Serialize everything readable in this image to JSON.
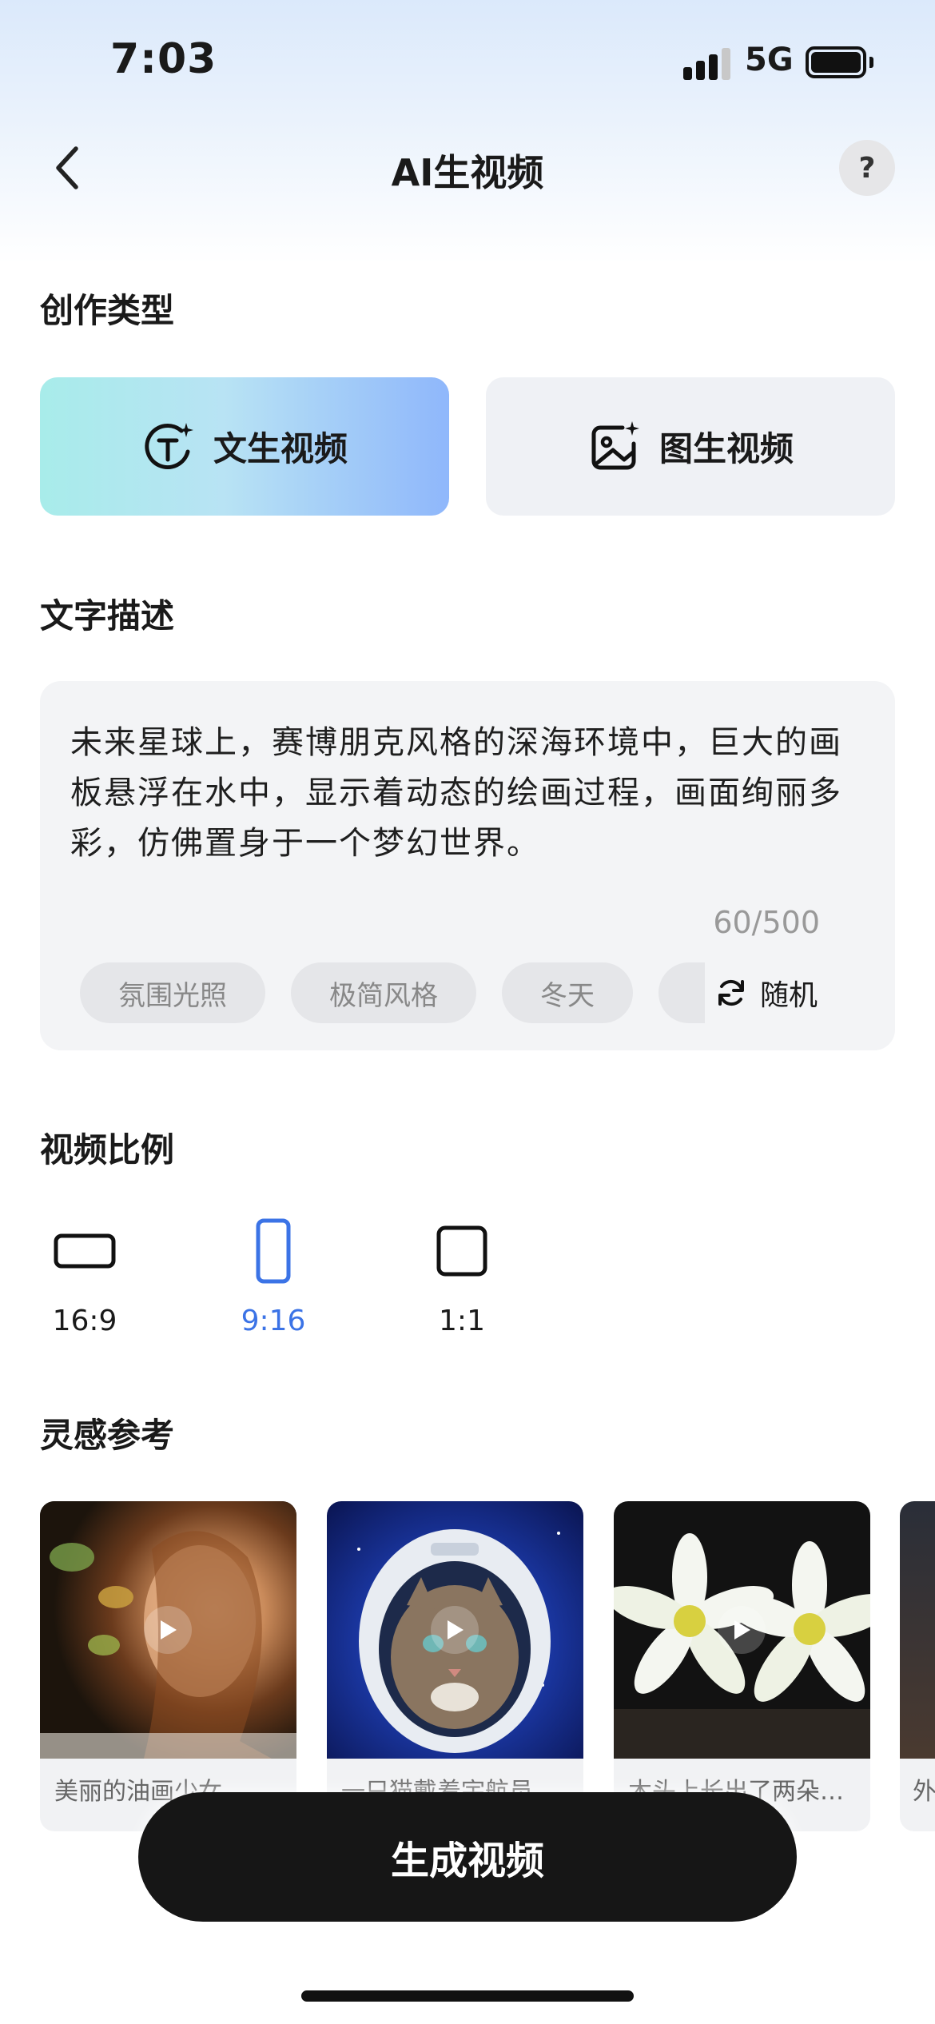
{
  "status_bar": {
    "time": "7:03",
    "network": "5G"
  },
  "nav": {
    "title": "AI生视频",
    "help_label": "?"
  },
  "creation_type": {
    "title": "创作类型",
    "options": [
      {
        "label": "文生视频",
        "icon": "text-ai-icon",
        "selected": true
      },
      {
        "label": "图生视频",
        "icon": "image-ai-icon",
        "selected": false
      }
    ]
  },
  "description": {
    "title": "文字描述",
    "text": "未来星球上，赛博朋克风格的深海环境中，巨大的画板悬浮在水中，显示着动态的绘画过程，画面绚丽多彩，仿佛置身于一个梦幻世界。",
    "counter": "60/500",
    "tags": [
      "氛围光照",
      "极简风格",
      "冬天"
    ],
    "random_label": "随机"
  },
  "ratio": {
    "title": "视频比例",
    "options": [
      {
        "label": "16:9",
        "selected": false
      },
      {
        "label": "9:16",
        "selected": true
      },
      {
        "label": "1:1",
        "selected": false
      }
    ]
  },
  "inspiration": {
    "title": "灵感参考",
    "items": [
      {
        "caption": "美丽的油画少女，…"
      },
      {
        "caption": "一只猫戴着宇航员…"
      },
      {
        "caption": "木头上长出了两朵…"
      },
      {
        "caption": "外"
      }
    ]
  },
  "generate_label": "生成视频",
  "colors": {
    "accent": "#3b73e6",
    "button": "#161616",
    "card_bg": "#eff1f5"
  }
}
